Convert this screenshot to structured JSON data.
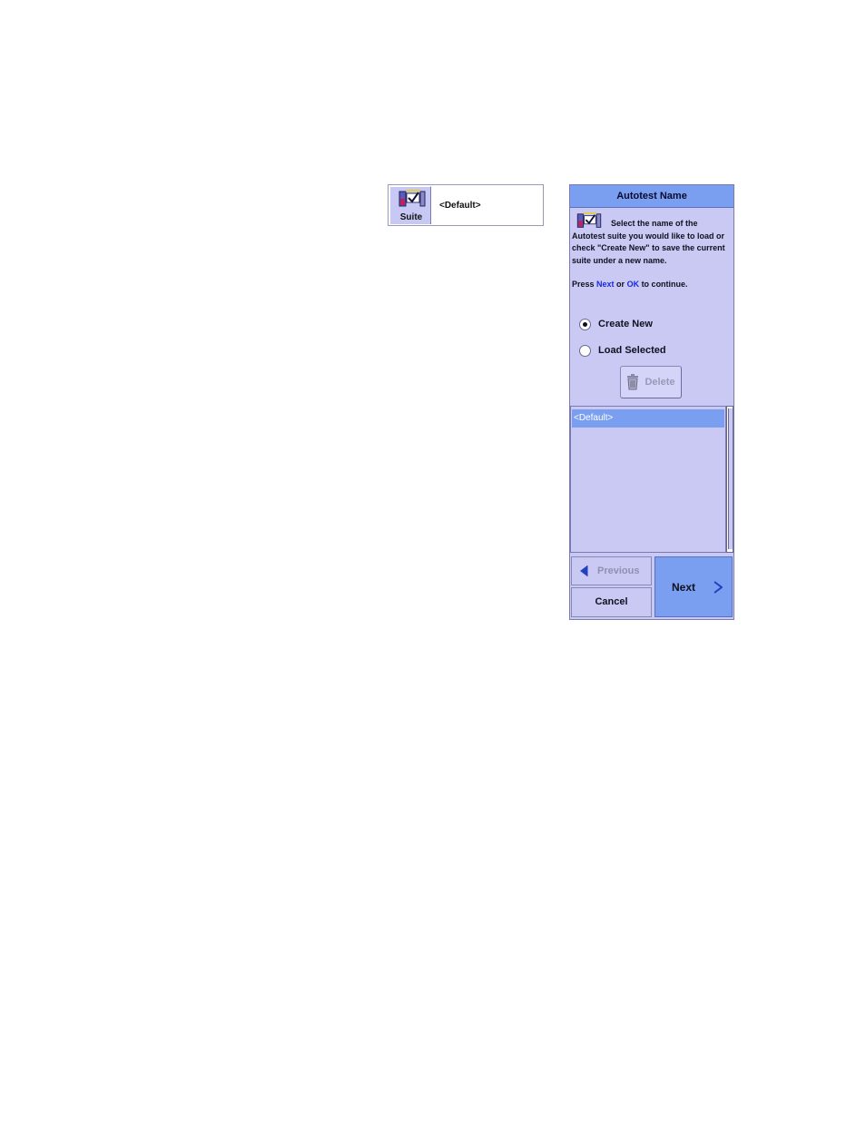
{
  "suite_widget": {
    "button_label": "Suite",
    "icon": "autotest-suite-icon",
    "value": "<Default>"
  },
  "dialog": {
    "title": "Autotest Name",
    "icon": "autotest-suite-icon",
    "instructions": "Select the name of the Autotest suite you would like to load or check \"Create New\" to save the current suite under a new name.",
    "press_prefix": "Press ",
    "press_next": "Next",
    "press_or": " or ",
    "press_ok": "OK",
    "press_suffix": " to continue.",
    "options": [
      {
        "label": "Create New",
        "selected": true
      },
      {
        "label": "Load Selected",
        "selected": false
      }
    ],
    "delete_label": "Delete",
    "list_items": [
      "<Default>"
    ],
    "previous_label": "Previous",
    "cancel_label": "Cancel",
    "next_label": "Next"
  },
  "colors": {
    "panel_bg": "#c9c9f4",
    "accent": "#7b9ff0",
    "keyword": "#1a2ad8"
  }
}
